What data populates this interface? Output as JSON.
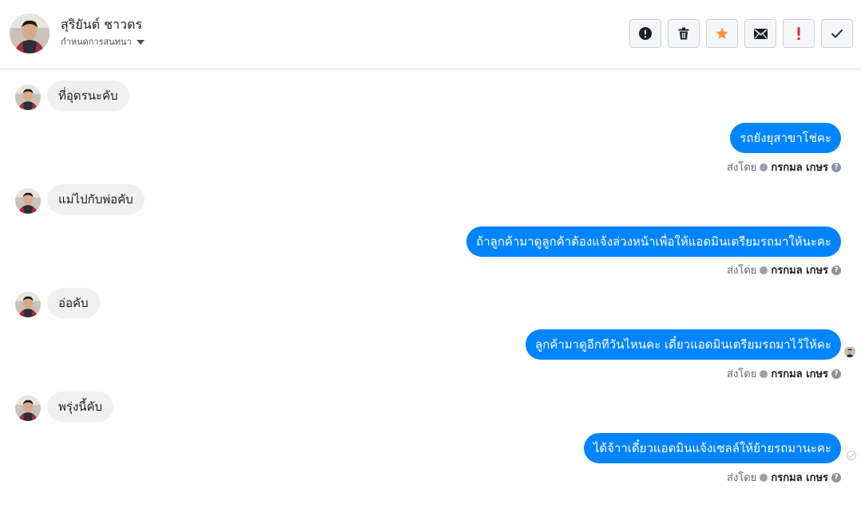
{
  "header": {
    "contact_name": "สุริยันต์ ชาวดร",
    "assign_label": "กำหนดการสนทนา"
  },
  "toolbar": {
    "buttons": [
      {
        "name": "report-spam-button",
        "icon": "exclamation-circle-icon"
      },
      {
        "name": "delete-button",
        "icon": "trash-icon"
      },
      {
        "name": "star-button",
        "icon": "star-icon",
        "color": "#f7923b"
      },
      {
        "name": "mark-unread-button",
        "icon": "envelope-icon"
      },
      {
        "name": "follow-up-button",
        "icon": "exclamation-icon",
        "color": "#e03030"
      },
      {
        "name": "mark-done-button",
        "icon": "check-icon"
      }
    ]
  },
  "messages": [
    {
      "direction": "in",
      "text": "ที่อุดรนะคับ"
    },
    {
      "direction": "out",
      "text": "รถยังยุสาขาโช่คะ",
      "sent_by_label": "ส่งโดย",
      "sender": "กรกมล เกษร"
    },
    {
      "direction": "in",
      "text": "แม่ไปกับพ่อคับ"
    },
    {
      "direction": "out",
      "text": "ถ้าลูกค้ามาดูลูกค้าต้องแจ้งล่วงหน้าเพื่อให้แอดมินเตรียมรถมาให้นะคะ",
      "sent_by_label": "ส่งโดย",
      "sender": "กรกมล เกษร"
    },
    {
      "direction": "in",
      "text": "อ่อคับ"
    },
    {
      "direction": "out",
      "text": "ลูกค้ามาดูอีกทีวันไหนคะ เดี๋ยวแอดมินเตรียมรถมาไว้ให้คะ",
      "sent_by_label": "ส่งโดย",
      "sender": "กรกมล เกษร"
    },
    {
      "direction": "in",
      "text": "พรุ่งนี้คับ"
    },
    {
      "direction": "out",
      "text": "ได้จ้าาเดี๋ยวแอดมินแจ้งเซลล์ให้ย้ายรถมานะคะ",
      "sent_by_label": "ส่งโดย",
      "sender": "กรกมล เกษร"
    }
  ],
  "colors": {
    "outgoing_bubble": "#0084ff",
    "incoming_bubble": "#f1f0f0"
  }
}
